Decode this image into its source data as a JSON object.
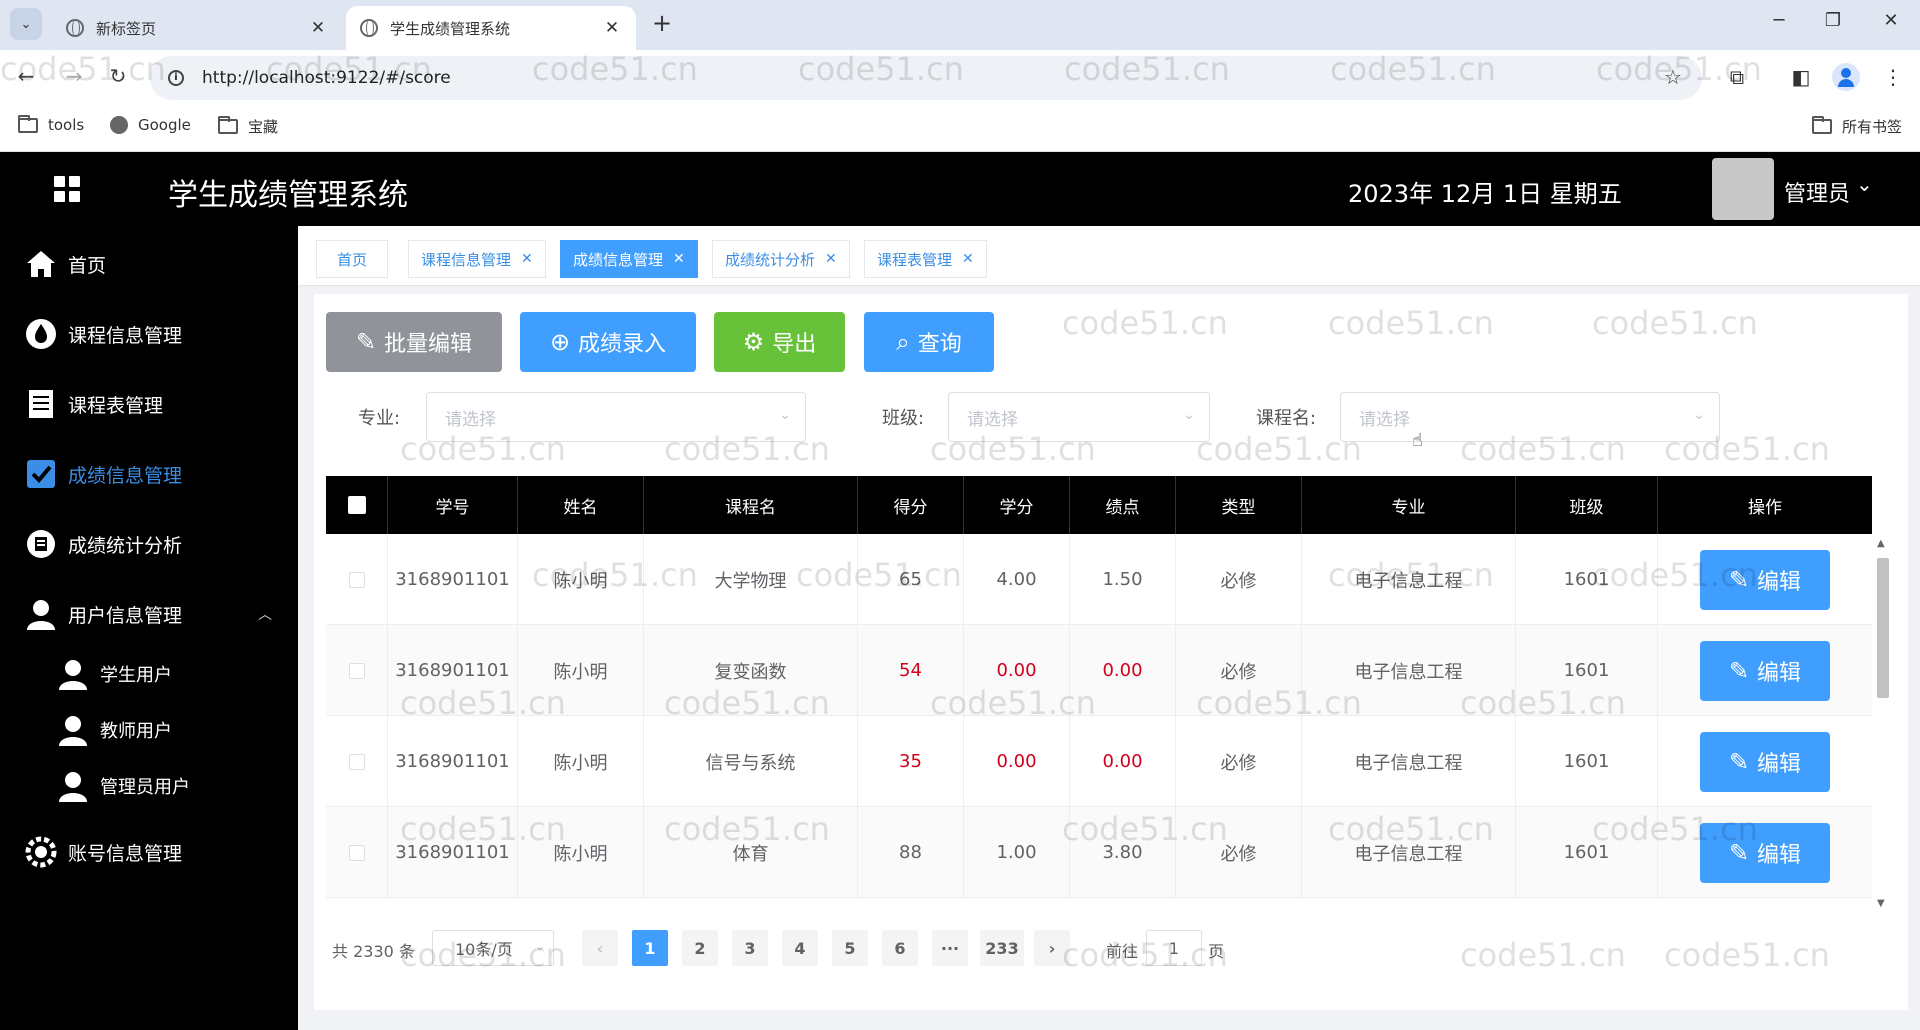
{
  "browser": {
    "tabs": [
      {
        "title": "新标签页"
      },
      {
        "title": "学生成绩管理系统"
      }
    ],
    "url": "http://localhost:9122/#/score",
    "bookmarks": [
      {
        "label": "tools"
      },
      {
        "label": "Google"
      },
      {
        "label": "宝藏"
      }
    ],
    "all_bookmarks": "所有书签"
  },
  "header": {
    "title": "学生成绩管理系统",
    "date": "2023年 12月 1日   星期五",
    "user": "管理员"
  },
  "sidebar": {
    "items": [
      {
        "label": "首页",
        "icon": "home-icon"
      },
      {
        "label": "课程信息管理",
        "icon": "drop-icon"
      },
      {
        "label": "课程表管理",
        "icon": "document-icon"
      },
      {
        "label": "成绩信息管理",
        "icon": "checkbox-icon"
      },
      {
        "label": "成绩统计分析",
        "icon": "badge-icon"
      },
      {
        "label": "用户信息管理",
        "icon": "user-icon"
      },
      {
        "label": "学生用户",
        "icon": "user-icon"
      },
      {
        "label": "教师用户",
        "icon": "user-icon"
      },
      {
        "label": "管理员用户",
        "icon": "user-icon"
      },
      {
        "label": "账号信息管理",
        "icon": "gear-icon"
      }
    ]
  },
  "tags": [
    {
      "label": "首页"
    },
    {
      "label": "课程信息管理"
    },
    {
      "label": "成绩信息管理"
    },
    {
      "label": "成绩统计分析"
    },
    {
      "label": "课程表管理"
    }
  ],
  "toolbar": {
    "batch_edit": "批量编辑",
    "score_entry": "成绩录入",
    "export": "导出",
    "query": "查询"
  },
  "filters": {
    "major_label": "专业:",
    "class_label": "班级:",
    "course_label": "课程名:",
    "placeholder": "请选择"
  },
  "table": {
    "columns": [
      "学号",
      "姓名",
      "课程名",
      "得分",
      "学分",
      "绩点",
      "类型",
      "专业",
      "班级",
      "操作"
    ],
    "rows": [
      {
        "id": "3168901101",
        "name": "陈小明",
        "course": "大学物理",
        "score": "65",
        "credit": "4.00",
        "gpa": "1.50",
        "type": "必修",
        "major": "电子信息工程",
        "class": "1601",
        "fail": false
      },
      {
        "id": "3168901101",
        "name": "陈小明",
        "course": "复变函数",
        "score": "54",
        "credit": "0.00",
        "gpa": "0.00",
        "type": "必修",
        "major": "电子信息工程",
        "class": "1601",
        "fail": true
      },
      {
        "id": "3168901101",
        "name": "陈小明",
        "course": "信号与系统",
        "score": "35",
        "credit": "0.00",
        "gpa": "0.00",
        "type": "必修",
        "major": "电子信息工程",
        "class": "1601",
        "fail": true
      },
      {
        "id": "3168901101",
        "name": "陈小明",
        "course": "体育",
        "score": "88",
        "credit": "1.00",
        "gpa": "3.80",
        "type": "必修",
        "major": "电子信息工程",
        "class": "1601",
        "fail": false
      }
    ],
    "edit_label": "编辑"
  },
  "pagination": {
    "total": "共 2330 条",
    "page_size": "10条/页",
    "pages": [
      "1",
      "2",
      "3",
      "4",
      "5",
      "6",
      "···",
      "233"
    ],
    "current": "1",
    "goto_label": "前往",
    "goto_value": "1",
    "page_suffix": "页"
  },
  "watermark": "code51.cn",
  "colors": {
    "primary": "#409eff",
    "success": "#67c23a",
    "info": "#909399",
    "danger": "#d0021b"
  }
}
